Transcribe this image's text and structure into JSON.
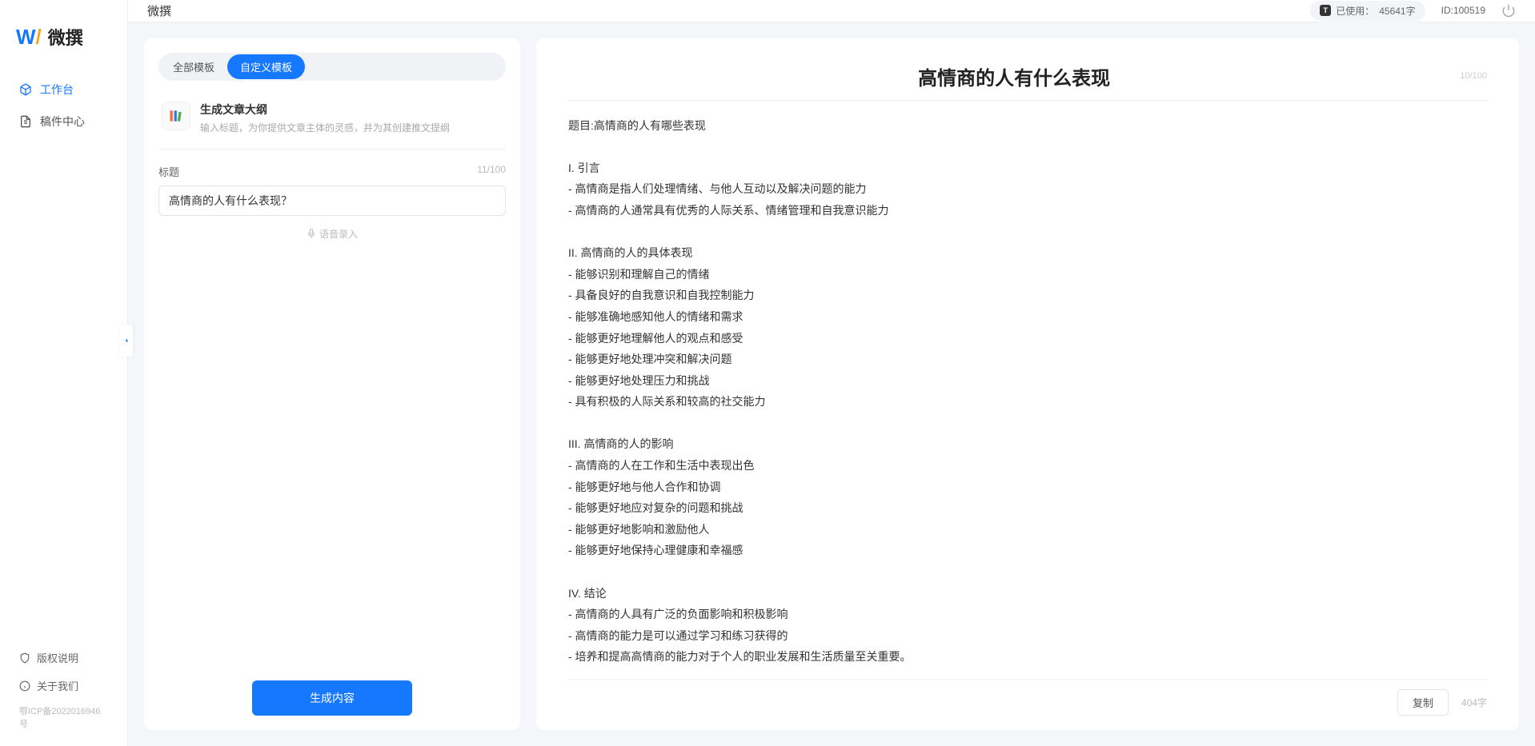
{
  "app": {
    "logo_text": "微撰",
    "title": "微撰"
  },
  "sidebar": {
    "nav": [
      {
        "label": "工作台",
        "active": true
      },
      {
        "label": "稿件中心",
        "active": false
      }
    ],
    "footer": {
      "copyright": "版权说明",
      "about": "关于我们",
      "icp": "鄂ICP备2022016946号"
    }
  },
  "topbar": {
    "usage_prefix": "已使用：",
    "usage_value": "45641字",
    "user_id_label": "ID:100519"
  },
  "left_panel": {
    "tabs": [
      {
        "label": "全部模板",
        "active": false
      },
      {
        "label": "自定义模板",
        "active": true
      }
    ],
    "template": {
      "title": "生成文章大纲",
      "desc": "输入标题，为你提供文章主体的灵感，并为其创建推文提纲"
    },
    "form": {
      "title_label": "标题",
      "title_counter": "11/100",
      "title_value": "高情商的人有什么表现？",
      "voice_label": "语音录入"
    },
    "generate_label": "生成内容"
  },
  "output": {
    "title": "高情商的人有什么表现",
    "title_counter": "10/100",
    "body": "题目:高情商的人有哪些表现\n\nI. 引言\n- 高情商是指人们处理情绪、与他人互动以及解决问题的能力\n- 高情商的人通常具有优秀的人际关系、情绪管理和自我意识能力\n\nII. 高情商的人的具体表现\n- 能够识别和理解自己的情绪\n- 具备良好的自我意识和自我控制能力\n- 能够准确地感知他人的情绪和需求\n- 能够更好地理解他人的观点和感受\n- 能够更好地处理冲突和解决问题\n- 能够更好地处理压力和挑战\n- 具有积极的人际关系和较高的社交能力\n\nIII. 高情商的人的影响\n- 高情商的人在工作和生活中表现出色\n- 能够更好地与他人合作和协调\n- 能够更好地应对复杂的问题和挑战\n- 能够更好地影响和激励他人\n- 能够更好地保持心理健康和幸福感\n\nIV. 结论\n- 高情商的人具有广泛的负面影响和积极影响\n- 高情商的能力是可以通过学习和练习获得的\n- 培养和提高高情商的能力对于个人的职业发展和生活质量至关重要。",
    "copy_label": "复制",
    "word_count": "404字"
  }
}
